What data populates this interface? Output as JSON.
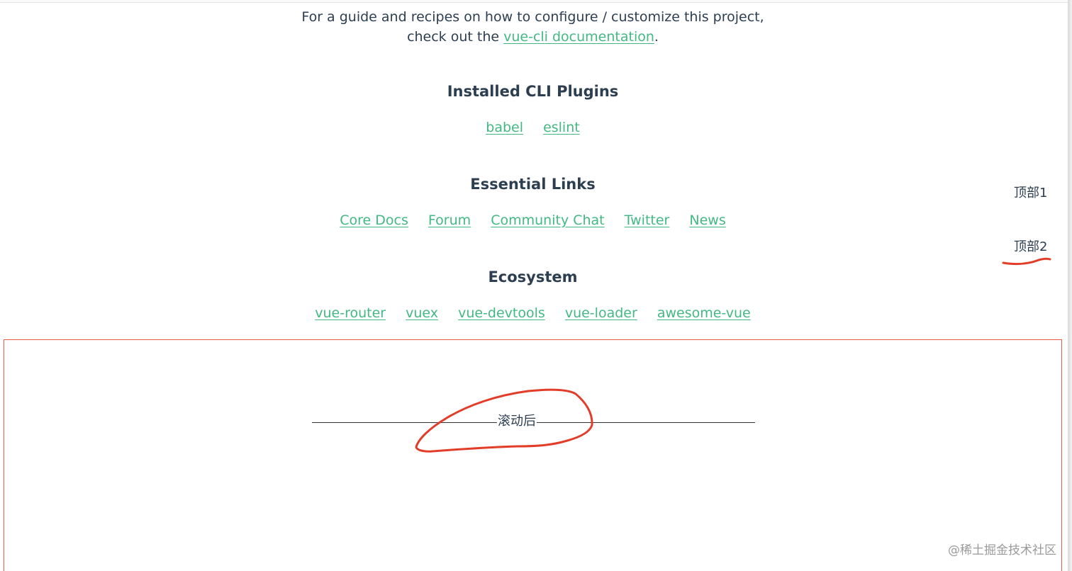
{
  "intro": {
    "line1": "For a guide and recipes on how to configure / customize this project,",
    "line2_prefix": "check out the ",
    "doc_link": "vue-cli documentation",
    "line2_suffix": "."
  },
  "plugins": {
    "title": "Installed CLI Plugins",
    "links": [
      "babel",
      "eslint"
    ]
  },
  "essential": {
    "title": "Essential Links",
    "links": [
      "Core Docs",
      "Forum",
      "Community Chat",
      "Twitter",
      "News"
    ]
  },
  "ecosystem": {
    "title": "Ecosystem",
    "links": [
      "vue-router",
      "vuex",
      "vue-devtools",
      "vue-loader",
      "awesome-vue"
    ]
  },
  "side_nav": {
    "item1": "顶部1",
    "item2": "顶部2"
  },
  "scroll_section": {
    "label": "滚动后"
  },
  "watermark": "@稀土掘金技术社区",
  "colors": {
    "link": "#42b983",
    "text": "#2c3e50",
    "annotation": "#e23d28",
    "box_border": "#e85a45"
  }
}
